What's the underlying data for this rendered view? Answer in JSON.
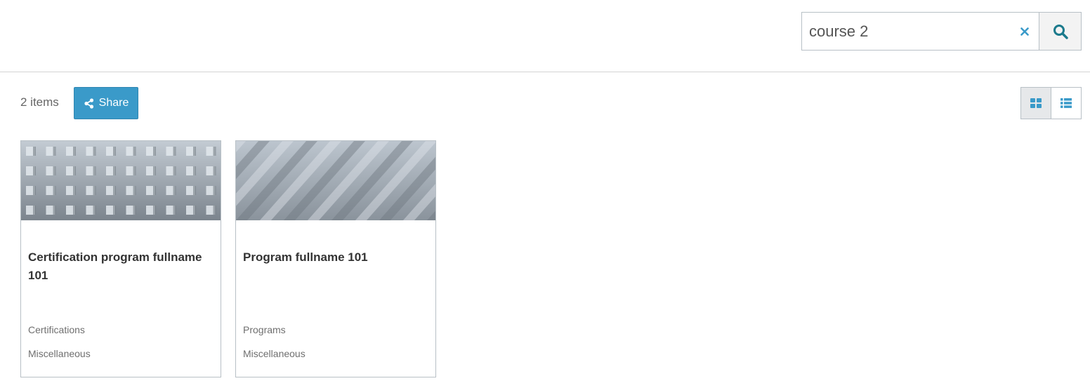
{
  "search": {
    "value": "course 2",
    "clear_icon": "times-icon",
    "button_icon": "search-icon"
  },
  "toolbar": {
    "count_label": "2 items",
    "share_label": "Share",
    "share_icon": "share-icon",
    "views": [
      {
        "name": "grid-view",
        "icon": "grid-icon",
        "active": true
      },
      {
        "name": "list-view",
        "icon": "list-icon",
        "active": false
      }
    ]
  },
  "cards": [
    {
      "title": "Certification program fullname 101",
      "type": "Certifications",
      "category": "Miscellaneous",
      "image_pattern": "squares"
    },
    {
      "title": "Program fullname 101",
      "type": "Programs",
      "category": "Miscellaneous",
      "image_pattern": "diagonal-stripes"
    }
  ],
  "colors": {
    "accent": "#3a9ac9",
    "search_icon": "#1b7a8c",
    "clear_icon": "#3a9ac9",
    "border": "#b8c0c6"
  }
}
